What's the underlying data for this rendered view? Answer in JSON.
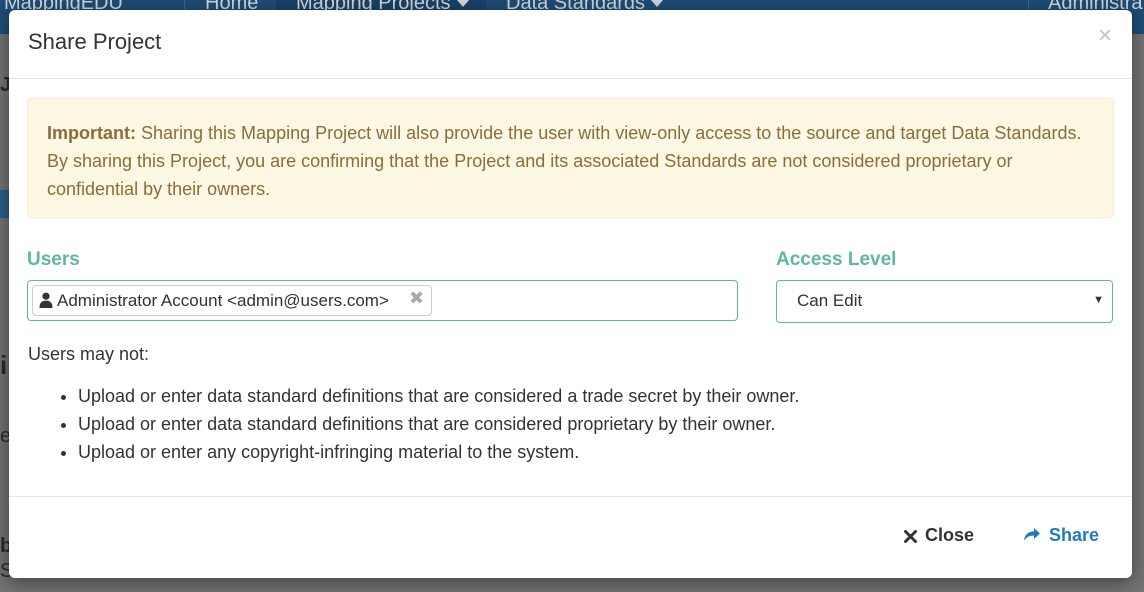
{
  "background": {
    "nav": {
      "brand": "MappingEDU",
      "items": [
        "Home",
        "Mapping Projects",
        "Data Standards"
      ],
      "right": "Administra"
    },
    "fragments": [
      "J",
      "i",
      "e",
      "b",
      "S"
    ]
  },
  "modal": {
    "title": "Share Project",
    "close_symbol": "×",
    "alert": {
      "strong": "Important:",
      "text": " Sharing this Mapping Project will also provide the user with view-only access to the source and target Data Standards. By sharing this Project, you are confirming that the Project and its associated Standards are not considered proprietary or confidential by their owners."
    },
    "users": {
      "label": "Users",
      "selected": [
        {
          "text": "Administrator Account <admin@users.com>",
          "remove": "✖"
        }
      ]
    },
    "access": {
      "label": "Access Level",
      "value": "Can Edit",
      "arrow": "▼"
    },
    "restrictions": {
      "intro": "Users may not:",
      "items": [
        "Upload or enter data standard definitions that are considered a trade secret by their owner.",
        "Upload or enter data standard definitions that are considered proprietary by their owner.",
        "Upload or enter any copyright-infringing material to the system."
      ]
    },
    "footer": {
      "close_label": "Close",
      "share_label": "Share"
    }
  },
  "colors": {
    "accent": "#5fb7a2",
    "link": "#1f7bc1",
    "alert_bg": "#fcf8e3",
    "alert_text": "#8a6d3b"
  }
}
